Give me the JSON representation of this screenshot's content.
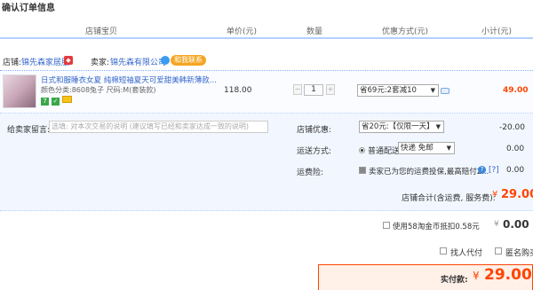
{
  "page_title": "确认订单信息",
  "columns": {
    "shop_item": "店铺宝贝",
    "unit_price": "单价(元)",
    "quantity": "数量",
    "discount": "优惠方式(元)",
    "subtotal": "小计(元)"
  },
  "seller": {
    "shop_label": "店铺:",
    "shop_name": "锦先森家居服",
    "seller_label": "卖家:",
    "seller_name": "锦先森有限公司",
    "contact_label": "和我联系"
  },
  "item": {
    "title": "日式和服睡衣女夏 纯棉短袖夏天可爱甜美韩新薄款...",
    "attrs": "颜色分类:8608兔子  尺码:M(套装款)",
    "unit_price": "118.00",
    "quantity": "1",
    "stepper_minus": "−",
    "stepper_plus": "+",
    "discount_option": "省69元:2套减10",
    "subtotal": "49.00"
  },
  "memo": {
    "label": "给卖家留言:",
    "placeholder": "选填: 对本次交易的说明 (建议填写已经和卖家达成一致的说明)"
  },
  "shop_discount": {
    "label": "店铺优惠:",
    "option": "省20元:【仅限一天】",
    "value": "-20.00"
  },
  "shipping": {
    "label": "运送方式:",
    "type": "普通配送",
    "option": "快递 免邮",
    "value": "0.00"
  },
  "insurance": {
    "label": "运费险:",
    "text": "卖家已为您的运费投保,最高赔付2...",
    "help": "?",
    "link": "[?]",
    "value": "0.00"
  },
  "shop_total": {
    "label": "店铺合计(含运费, 服务费):",
    "currency": "¥",
    "amount": "29.00"
  },
  "coins": {
    "label": "使用58淘金币抵扣0.58元",
    "currency": "¥",
    "amount": "0.00"
  },
  "options": {
    "proxy_pay": "找人代付",
    "anonymous": "匿名购买"
  },
  "payment": {
    "label": "实付款:",
    "currency": "¥",
    "amount": "29.00"
  },
  "colors": {
    "accent": "#ff4400",
    "border_blue": "#b2d1ff",
    "link": "#3366cc"
  }
}
